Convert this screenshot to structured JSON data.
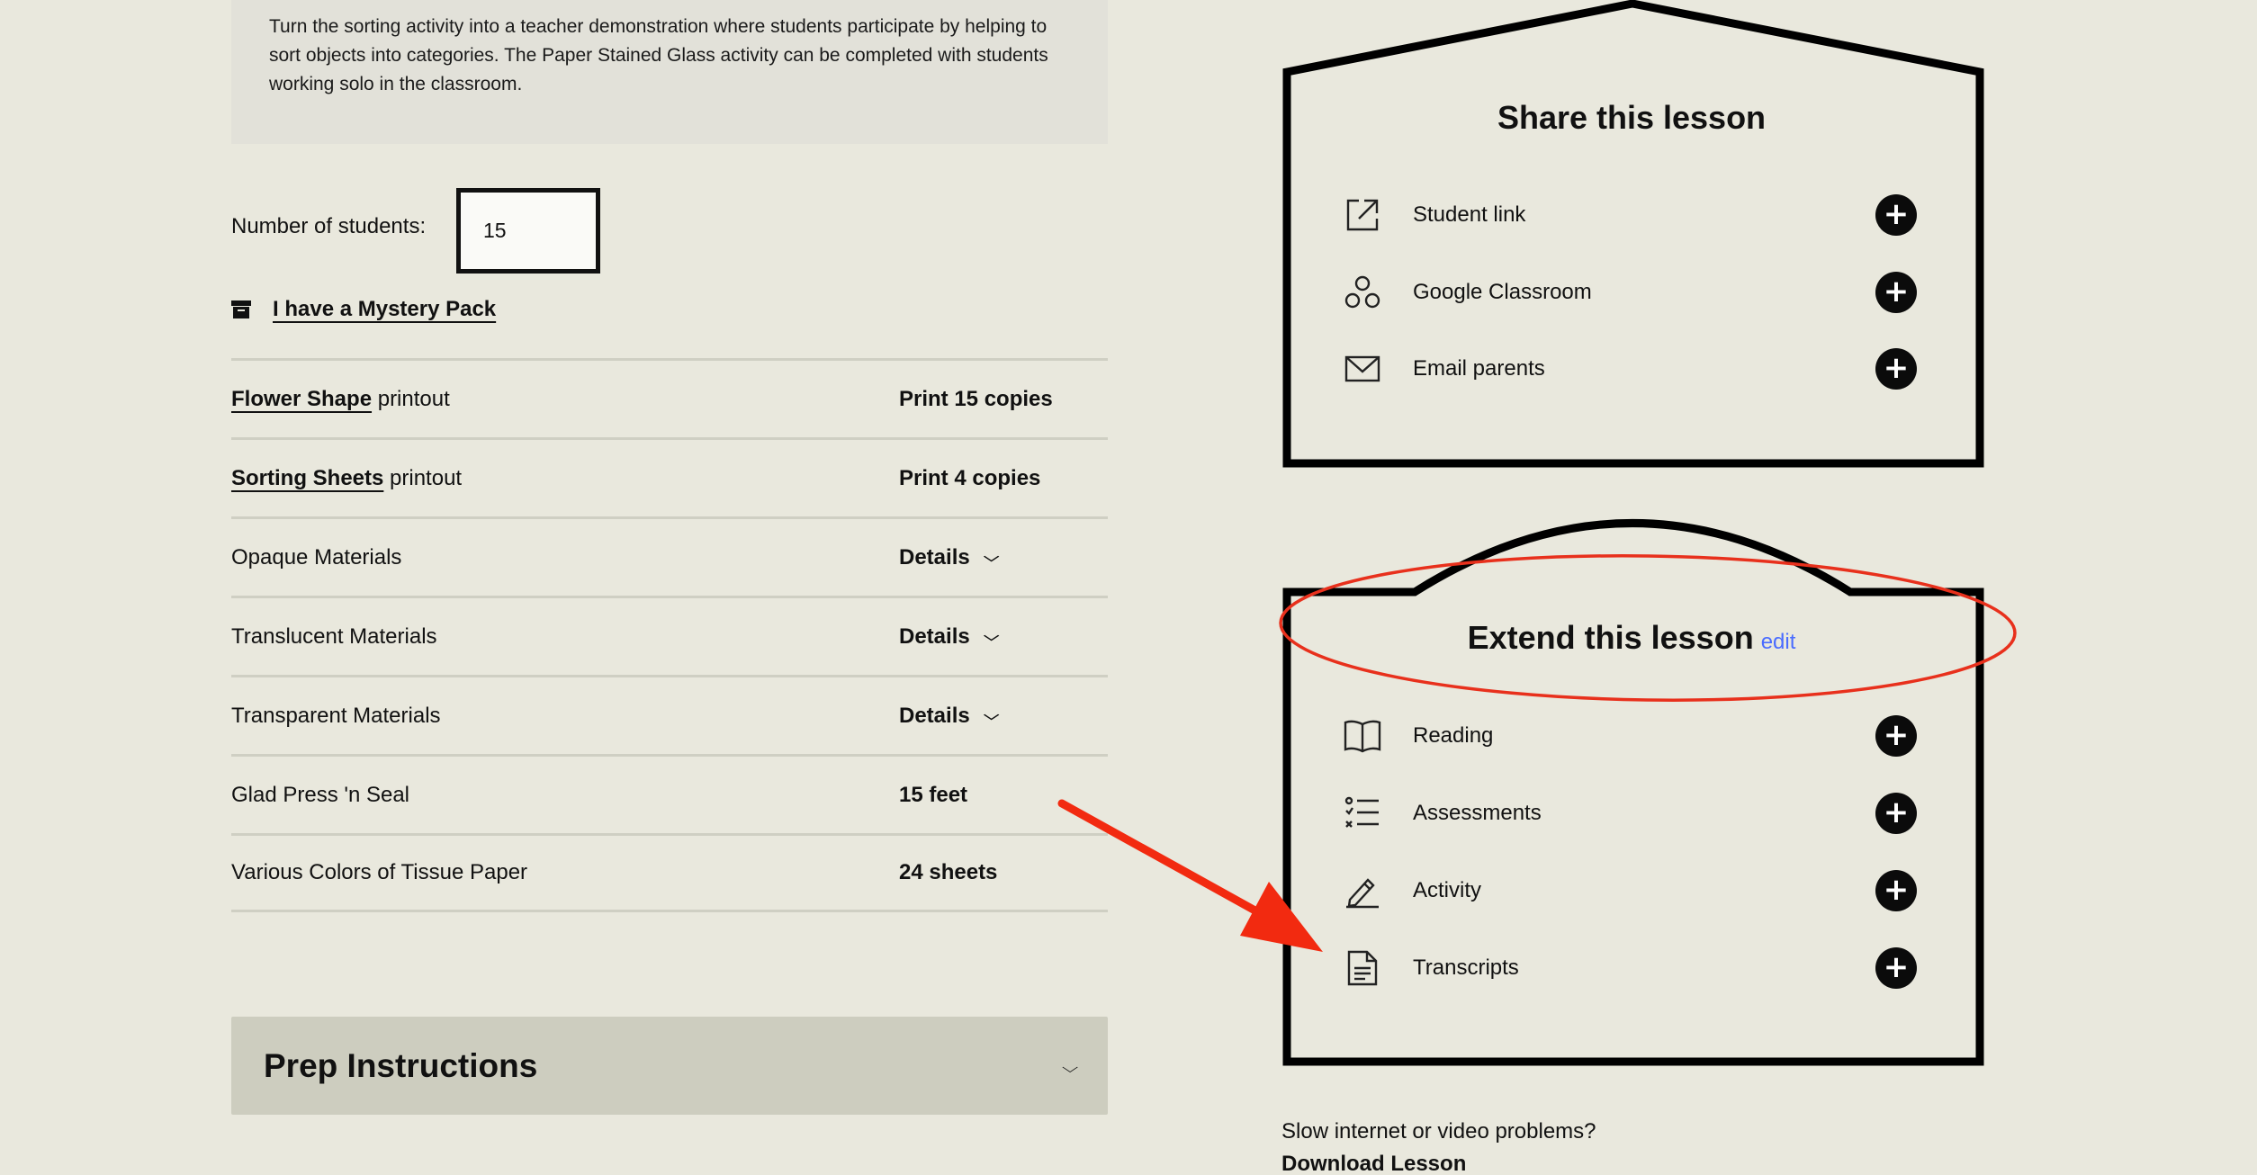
{
  "activity_note": {
    "text": "Turn the sorting activity into a teacher demonstration where students participate by helping to sort objects into categories. The Paper Stained Glass activity can be completed with students working solo in the classroom."
  },
  "students": {
    "label": "Number of students:",
    "value": "15"
  },
  "mystery_pack": {
    "label": "I have a Mystery Pack",
    "icon": "box-icon"
  },
  "materials": [
    {
      "link": "Flower Shape",
      "suffix": " printout",
      "qty": "Print 15 copies",
      "has_details": false
    },
    {
      "link": "Sorting Sheets",
      "suffix": " printout",
      "qty": "Print 4 copies",
      "has_details": false
    },
    {
      "link": "",
      "suffix": "Opaque Materials",
      "qty": "Details",
      "has_details": true
    },
    {
      "link": "",
      "suffix": "Translucent Materials",
      "qty": "Details",
      "has_details": true
    },
    {
      "link": "",
      "suffix": "Transparent Materials",
      "qty": "Details",
      "has_details": true
    },
    {
      "link": "",
      "suffix": "Glad Press 'n Seal",
      "qty": "15 feet",
      "has_details": false
    },
    {
      "link": "",
      "suffix": "Various Colors of Tissue Paper",
      "qty": "24 sheets",
      "has_details": false
    }
  ],
  "prep": {
    "title": "Prep Instructions"
  },
  "share": {
    "title": "Share this lesson",
    "items": [
      {
        "label": "Student link",
        "icon": "external-link-icon"
      },
      {
        "label": "Google Classroom",
        "icon": "google-classroom-icon"
      },
      {
        "label": "Email parents",
        "icon": "envelope-icon"
      }
    ]
  },
  "extend": {
    "title": "Extend this lesson",
    "edit_label": "edit",
    "items": [
      {
        "label": "Reading",
        "icon": "book-icon"
      },
      {
        "label": "Assessments",
        "icon": "checklist-icon"
      },
      {
        "label": "Activity",
        "icon": "pencil-icon"
      },
      {
        "label": "Transcripts",
        "icon": "document-icon"
      }
    ]
  },
  "footer": {
    "slow_text": "Slow internet or video problems?",
    "download_label": "Download Lesson"
  },
  "annotation": {
    "ellipse_color": "#e8301c",
    "arrow_color": "#f22a10"
  }
}
